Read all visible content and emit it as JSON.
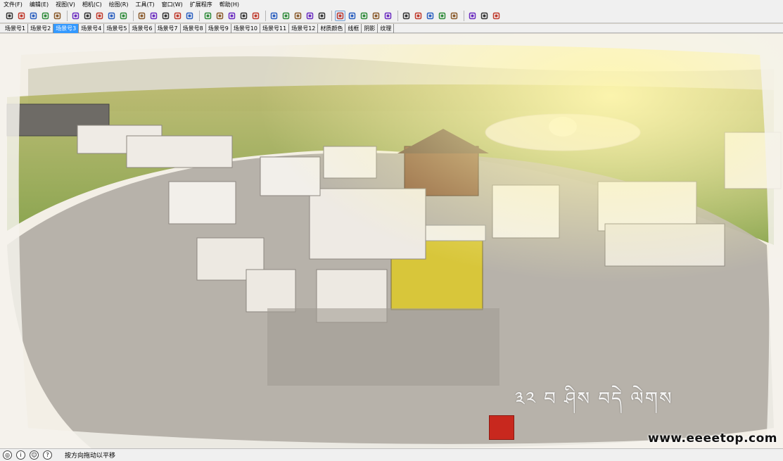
{
  "menu": [
    "文件(F)",
    "编辑(E)",
    "视图(V)",
    "相机(C)",
    "绘图(R)",
    "工具(T)",
    "窗口(W)",
    "扩展程序",
    "帮助(H)"
  ],
  "toolbar": {
    "icons": [
      "select-icon",
      "eraser-icon",
      "pencil-icon",
      "arc-icon",
      "rectangle-icon",
      "push-pull-icon",
      "rotate-icon",
      "move-icon",
      "rotate-arrows-icon",
      "scale-icon",
      "tape-measure-icon",
      "protractor-icon",
      "paint-bucket-icon",
      "orbit-icon",
      "pan-icon",
      "zoom-icon",
      "zoom-extents-icon",
      "component-icon",
      "warehouse-icon",
      "extension-icon",
      "style-icon",
      "section-icon",
      "search-icon",
      "undo-view-icon",
      "redo-view-icon",
      "walk-icon",
      "look-around-icon",
      "sandbox-icon",
      "follow-me-icon",
      "undo-icon",
      "redo-icon",
      "erase-history-icon",
      "material-icon",
      "box-icon",
      "shadow-icon",
      "texture-icon",
      "fog-icon",
      "help-icon"
    ],
    "active_index": 25
  },
  "scenes": {
    "tabs": [
      "场景号1",
      "场景号2",
      "场景号3",
      "场景号4",
      "场景号5",
      "场景号6",
      "场景号7",
      "场景号8",
      "场景号9",
      "场景号10",
      "场景号11",
      "场景号12",
      "材质颜色",
      "线框",
      "阴影",
      "纹理"
    ],
    "active_index": 2
  },
  "viewport": {
    "title_text": "༣༢ བ ཤིས བདེ ལེགས",
    "watermark": "www.eeeetop.com"
  },
  "status": {
    "icons": [
      "location-icon",
      "info-icon",
      "user-icon",
      "help-icon"
    ],
    "icon_glyphs": [
      "◎",
      "i",
      "☺",
      "?"
    ],
    "text": "按方向拖动以平移"
  }
}
